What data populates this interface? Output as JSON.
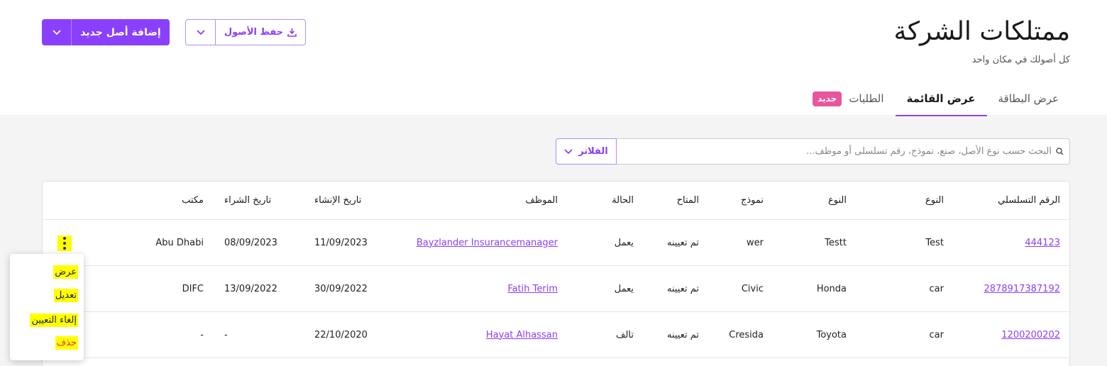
{
  "header": {
    "title": "ممتلكات الشركة",
    "subtitle": "كل أصولك في مكان واحد",
    "add_button_label": "إضافة أصل جديد",
    "save_button_label": "حفظ الأصول"
  },
  "tabs": [
    {
      "label": "عرض البطاقة"
    },
    {
      "label": "عرض القائمة"
    },
    {
      "label": "الطلبات",
      "badge": "جديد"
    }
  ],
  "search": {
    "placeholder": "البحث حسب نوع الأصل، صنع، نموذج، رقم تسلسلى أو موظف...",
    "filter_label": "الفلاتر"
  },
  "table": {
    "columns": [
      "الرقم التسلسلي",
      "النوع",
      "النوع",
      "نموذج",
      "المتاح",
      "الحالة",
      "الموظف",
      "تاريخ الإنشاء",
      "تاريخ الشراء",
      "مكتب"
    ],
    "rows": [
      [
        "444123",
        "Test",
        "Testt",
        "wer",
        "تم تعيينه",
        "يعمل",
        "Bayzlander Insurancemanager",
        "11/09/2023",
        "08/09/2023",
        "Abu Dhabi"
      ],
      [
        "2878917387192",
        "car",
        "Honda",
        "Civic",
        "تم تعيينه",
        "يعمل",
        "Fatih Terim",
        "30/09/2022",
        "13/09/2022",
        "DIFC"
      ],
      [
        "1200200202",
        "car",
        "Toyota",
        "Cresida",
        "تم تعيينه",
        "تالف",
        "Hayat Alhassan",
        "22/10/2020",
        "-",
        "-"
      ]
    ]
  },
  "context_menu": {
    "items": [
      "عرض",
      "تعديل",
      "إلغاء التعيين",
      "حذف"
    ]
  },
  "colors": {
    "accent": "#8a3ffc",
    "badge": "#e8559d",
    "highlight": "#ffff00",
    "danger": "#e8314f"
  }
}
